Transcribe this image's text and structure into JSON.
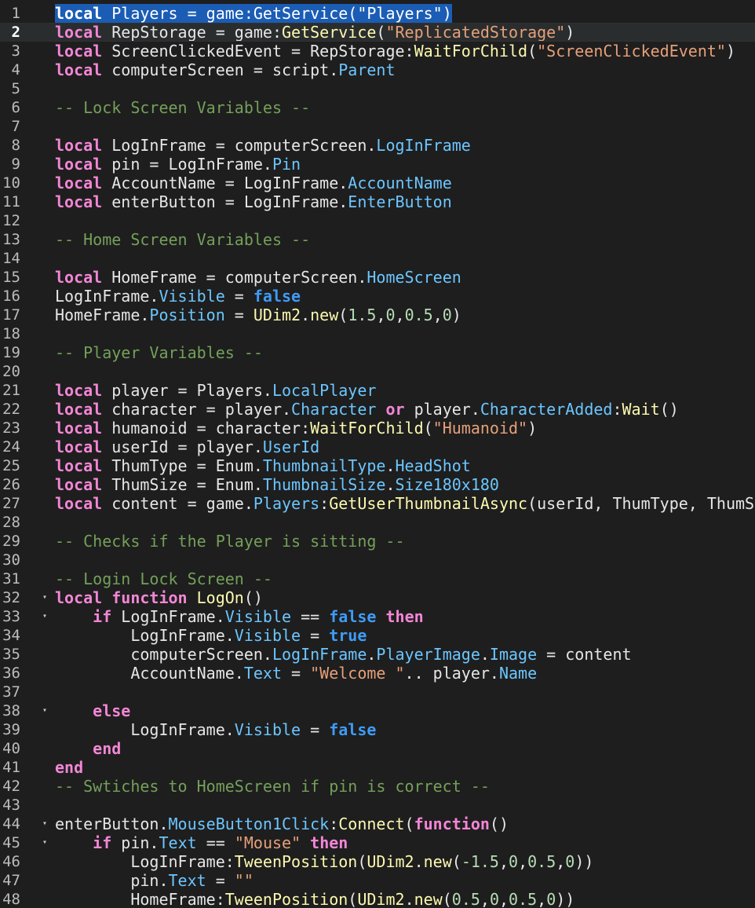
{
  "editor": {
    "title": "",
    "lines": [
      {
        "n": "1",
        "fold": false,
        "current": false,
        "selected": true,
        "tokens": [
          [
            "kw",
            "local"
          ],
          [
            "id",
            " Players = game:GetService(\"Players\")"
          ]
        ]
      },
      {
        "n": "2",
        "fold": false,
        "current": true,
        "tokens": [
          [
            "kw",
            "local"
          ],
          [
            "id",
            " RepStorage = game:"
          ],
          [
            "meth",
            "GetService"
          ],
          [
            "op",
            "("
          ],
          [
            "str",
            "\"ReplicatedStorage\""
          ],
          [
            "op",
            ")"
          ]
        ]
      },
      {
        "n": "3",
        "fold": false,
        "tokens": [
          [
            "kw",
            "local"
          ],
          [
            "id",
            " ScreenClickedEvent = RepStorage:"
          ],
          [
            "meth",
            "WaitForChild"
          ],
          [
            "op",
            "("
          ],
          [
            "str",
            "\"ScreenClickedEvent\""
          ],
          [
            "op",
            ")"
          ]
        ]
      },
      {
        "n": "4",
        "fold": false,
        "tokens": [
          [
            "kw",
            "local"
          ],
          [
            "id",
            " computerScreen = script."
          ],
          [
            "prop",
            "Parent"
          ]
        ]
      },
      {
        "n": "5",
        "fold": false,
        "tokens": []
      },
      {
        "n": "6",
        "fold": false,
        "tokens": [
          [
            "cmt",
            "-- Lock Screen Variables --"
          ]
        ]
      },
      {
        "n": "7",
        "fold": false,
        "tokens": []
      },
      {
        "n": "8",
        "fold": false,
        "tokens": [
          [
            "kw",
            "local"
          ],
          [
            "id",
            " LogInFrame = computerScreen."
          ],
          [
            "prop",
            "LogInFrame"
          ]
        ]
      },
      {
        "n": "9",
        "fold": false,
        "tokens": [
          [
            "kw",
            "local"
          ],
          [
            "id",
            " pin = LogInFrame."
          ],
          [
            "prop",
            "Pin"
          ]
        ]
      },
      {
        "n": "10",
        "fold": false,
        "tokens": [
          [
            "kw",
            "local"
          ],
          [
            "id",
            " AccountName = LogInFrame."
          ],
          [
            "prop",
            "AccountName"
          ]
        ]
      },
      {
        "n": "11",
        "fold": false,
        "tokens": [
          [
            "kw",
            "local"
          ],
          [
            "id",
            " enterButton = LogInFrame."
          ],
          [
            "prop",
            "EnterButton"
          ]
        ]
      },
      {
        "n": "12",
        "fold": false,
        "tokens": []
      },
      {
        "n": "13",
        "fold": false,
        "tokens": [
          [
            "cmt",
            "-- Home Screen Variables --"
          ]
        ]
      },
      {
        "n": "14",
        "fold": false,
        "tokens": []
      },
      {
        "n": "15",
        "fold": false,
        "tokens": [
          [
            "kw",
            "local"
          ],
          [
            "id",
            " HomeFrame = computerScreen."
          ],
          [
            "prop",
            "HomeScreen"
          ]
        ]
      },
      {
        "n": "16",
        "fold": false,
        "tokens": [
          [
            "id",
            "LogInFrame."
          ],
          [
            "prop",
            "Visible"
          ],
          [
            "id",
            " = "
          ],
          [
            "bool",
            "false"
          ]
        ]
      },
      {
        "n": "17",
        "fold": false,
        "tokens": [
          [
            "id",
            "HomeFrame."
          ],
          [
            "prop",
            "Position"
          ],
          [
            "id",
            " = "
          ],
          [
            "meth",
            "UDim2"
          ],
          [
            "id",
            "."
          ],
          [
            "meth",
            "new"
          ],
          [
            "op",
            "("
          ],
          [
            "num",
            "1.5"
          ],
          [
            "op",
            ","
          ],
          [
            "num",
            "0"
          ],
          [
            "op",
            ","
          ],
          [
            "num",
            "0.5"
          ],
          [
            "op",
            ","
          ],
          [
            "num",
            "0"
          ],
          [
            "op",
            ")"
          ]
        ]
      },
      {
        "n": "18",
        "fold": false,
        "tokens": []
      },
      {
        "n": "19",
        "fold": false,
        "tokens": [
          [
            "cmt",
            "-- Player Variables --"
          ]
        ]
      },
      {
        "n": "20",
        "fold": false,
        "tokens": []
      },
      {
        "n": "21",
        "fold": false,
        "tokens": [
          [
            "kw",
            "local"
          ],
          [
            "id",
            " player = Players."
          ],
          [
            "prop",
            "LocalPlayer"
          ]
        ]
      },
      {
        "n": "22",
        "fold": false,
        "tokens": [
          [
            "kw",
            "local"
          ],
          [
            "id",
            " character = player."
          ],
          [
            "prop",
            "Character"
          ],
          [
            "id",
            " "
          ],
          [
            "kw",
            "or"
          ],
          [
            "id",
            " player."
          ],
          [
            "prop",
            "CharacterAdded"
          ],
          [
            "id",
            ":"
          ],
          [
            "meth",
            "Wait"
          ],
          [
            "op",
            "()"
          ]
        ]
      },
      {
        "n": "23",
        "fold": false,
        "tokens": [
          [
            "kw",
            "local"
          ],
          [
            "id",
            " humanoid = character:"
          ],
          [
            "meth",
            "WaitForChild"
          ],
          [
            "op",
            "("
          ],
          [
            "str",
            "\"Humanoid\""
          ],
          [
            "op",
            ")"
          ]
        ]
      },
      {
        "n": "24",
        "fold": false,
        "tokens": [
          [
            "kw",
            "local"
          ],
          [
            "id",
            " userId = player."
          ],
          [
            "prop",
            "UserId"
          ]
        ]
      },
      {
        "n": "25",
        "fold": false,
        "tokens": [
          [
            "kw",
            "local"
          ],
          [
            "id",
            " ThumType = Enum."
          ],
          [
            "prop",
            "ThumbnailType"
          ],
          [
            "id",
            "."
          ],
          [
            "prop",
            "HeadShot"
          ]
        ]
      },
      {
        "n": "26",
        "fold": false,
        "tokens": [
          [
            "kw",
            "local"
          ],
          [
            "id",
            " ThumSize = Enum."
          ],
          [
            "prop",
            "ThumbnailSize"
          ],
          [
            "id",
            "."
          ],
          [
            "prop",
            "Size180x180"
          ]
        ]
      },
      {
        "n": "27",
        "fold": false,
        "tokens": [
          [
            "kw",
            "local"
          ],
          [
            "id",
            " content = game."
          ],
          [
            "prop",
            "Players"
          ],
          [
            "id",
            ":"
          ],
          [
            "meth",
            "GetUserThumbnailAsync"
          ],
          [
            "op",
            "(userId, ThumType, ThumSi"
          ]
        ]
      },
      {
        "n": "28",
        "fold": false,
        "tokens": []
      },
      {
        "n": "29",
        "fold": false,
        "tokens": [
          [
            "cmt",
            "-- Checks if the Player is sitting --"
          ]
        ]
      },
      {
        "n": "30",
        "fold": false,
        "tokens": []
      },
      {
        "n": "31",
        "fold": false,
        "tokens": [
          [
            "cmt",
            "-- Login Lock Screen --"
          ]
        ]
      },
      {
        "n": "32",
        "fold": true,
        "tokens": [
          [
            "kw",
            "local"
          ],
          [
            "id",
            " "
          ],
          [
            "kw",
            "function"
          ],
          [
            "id",
            " "
          ],
          [
            "meth",
            "LogOn"
          ],
          [
            "op",
            "()"
          ]
        ]
      },
      {
        "n": "33",
        "fold": true,
        "tokens": [
          [
            "id",
            "    "
          ],
          [
            "kw",
            "if"
          ],
          [
            "id",
            " LogInFrame."
          ],
          [
            "prop",
            "Visible"
          ],
          [
            "id",
            " == "
          ],
          [
            "bool",
            "false"
          ],
          [
            "id",
            " "
          ],
          [
            "kw",
            "then"
          ]
        ]
      },
      {
        "n": "34",
        "fold": false,
        "tokens": [
          [
            "id",
            "        LogInFrame."
          ],
          [
            "prop",
            "Visible"
          ],
          [
            "id",
            " = "
          ],
          [
            "bool",
            "true"
          ]
        ]
      },
      {
        "n": "35",
        "fold": false,
        "tokens": [
          [
            "id",
            "        computerScreen."
          ],
          [
            "prop",
            "LogInFrame"
          ],
          [
            "id",
            "."
          ],
          [
            "prop",
            "PlayerImage"
          ],
          [
            "id",
            "."
          ],
          [
            "prop",
            "Image"
          ],
          [
            "id",
            " = content"
          ]
        ]
      },
      {
        "n": "36",
        "fold": false,
        "tokens": [
          [
            "id",
            "        AccountName."
          ],
          [
            "prop",
            "Text"
          ],
          [
            "id",
            " = "
          ],
          [
            "str",
            "\"Welcome \""
          ],
          [
            "id",
            ".. player."
          ],
          [
            "prop",
            "Name"
          ]
        ]
      },
      {
        "n": "37",
        "fold": false,
        "tokens": []
      },
      {
        "n": "38",
        "fold": true,
        "tokens": [
          [
            "id",
            "    "
          ],
          [
            "kw",
            "else"
          ]
        ]
      },
      {
        "n": "39",
        "fold": false,
        "tokens": [
          [
            "id",
            "        LogInFrame."
          ],
          [
            "prop",
            "Visible"
          ],
          [
            "id",
            " = "
          ],
          [
            "bool",
            "false"
          ]
        ]
      },
      {
        "n": "40",
        "fold": false,
        "tokens": [
          [
            "id",
            "    "
          ],
          [
            "kw",
            "end"
          ]
        ]
      },
      {
        "n": "41",
        "fold": false,
        "tokens": [
          [
            "kw",
            "end"
          ]
        ]
      },
      {
        "n": "42",
        "fold": false,
        "tokens": [
          [
            "cmt",
            "-- Swtiches to HomeScreen if pin is correct --"
          ]
        ]
      },
      {
        "n": "43",
        "fold": false,
        "tokens": []
      },
      {
        "n": "44",
        "fold": true,
        "tokens": [
          [
            "id",
            "enterButton."
          ],
          [
            "prop",
            "MouseButton1Click"
          ],
          [
            "id",
            ":"
          ],
          [
            "meth",
            "Connect"
          ],
          [
            "op",
            "("
          ],
          [
            "kw",
            "function"
          ],
          [
            "op",
            "()"
          ]
        ]
      },
      {
        "n": "45",
        "fold": true,
        "tokens": [
          [
            "id",
            "    "
          ],
          [
            "kw",
            "if"
          ],
          [
            "id",
            " pin."
          ],
          [
            "prop",
            "Text"
          ],
          [
            "id",
            " == "
          ],
          [
            "str",
            "\"Mouse\""
          ],
          [
            "id",
            " "
          ],
          [
            "kw",
            "then"
          ]
        ]
      },
      {
        "n": "46",
        "fold": false,
        "tokens": [
          [
            "id",
            "        LogInFrame:"
          ],
          [
            "meth",
            "TweenPosition"
          ],
          [
            "op",
            "("
          ],
          [
            "meth",
            "UDim2"
          ],
          [
            "id",
            "."
          ],
          [
            "meth",
            "new"
          ],
          [
            "op",
            "("
          ],
          [
            "num",
            "-1.5"
          ],
          [
            "op",
            ","
          ],
          [
            "num",
            "0"
          ],
          [
            "op",
            ","
          ],
          [
            "num",
            "0.5"
          ],
          [
            "op",
            ","
          ],
          [
            "num",
            "0"
          ],
          [
            "op",
            "))"
          ]
        ]
      },
      {
        "n": "47",
        "fold": false,
        "tokens": [
          [
            "id",
            "        pin."
          ],
          [
            "prop",
            "Text"
          ],
          [
            "id",
            " = "
          ],
          [
            "str",
            "\"\""
          ]
        ]
      },
      {
        "n": "48",
        "fold": false,
        "tokens": [
          [
            "id",
            "        HomeFrame:"
          ],
          [
            "meth",
            "TweenPosition"
          ],
          [
            "op",
            "("
          ],
          [
            "meth",
            "UDim2"
          ],
          [
            "id",
            "."
          ],
          [
            "meth",
            "new"
          ],
          [
            "op",
            "("
          ],
          [
            "num",
            "0.5"
          ],
          [
            "op",
            ","
          ],
          [
            "num",
            "0"
          ],
          [
            "op",
            ","
          ],
          [
            "num",
            "0.5"
          ],
          [
            "op",
            ","
          ],
          [
            "num",
            "0"
          ],
          [
            "op",
            "))"
          ]
        ]
      }
    ]
  },
  "colors": {
    "background": "#1e1e1e",
    "selection": "#1b5db5",
    "keyword": "#f386d6",
    "string": "#e6a07a",
    "property": "#6cc6ff",
    "method": "#fdf9b0",
    "comment": "#74a05a",
    "number": "#b7ddb6",
    "boolean": "#3e9cf6"
  }
}
